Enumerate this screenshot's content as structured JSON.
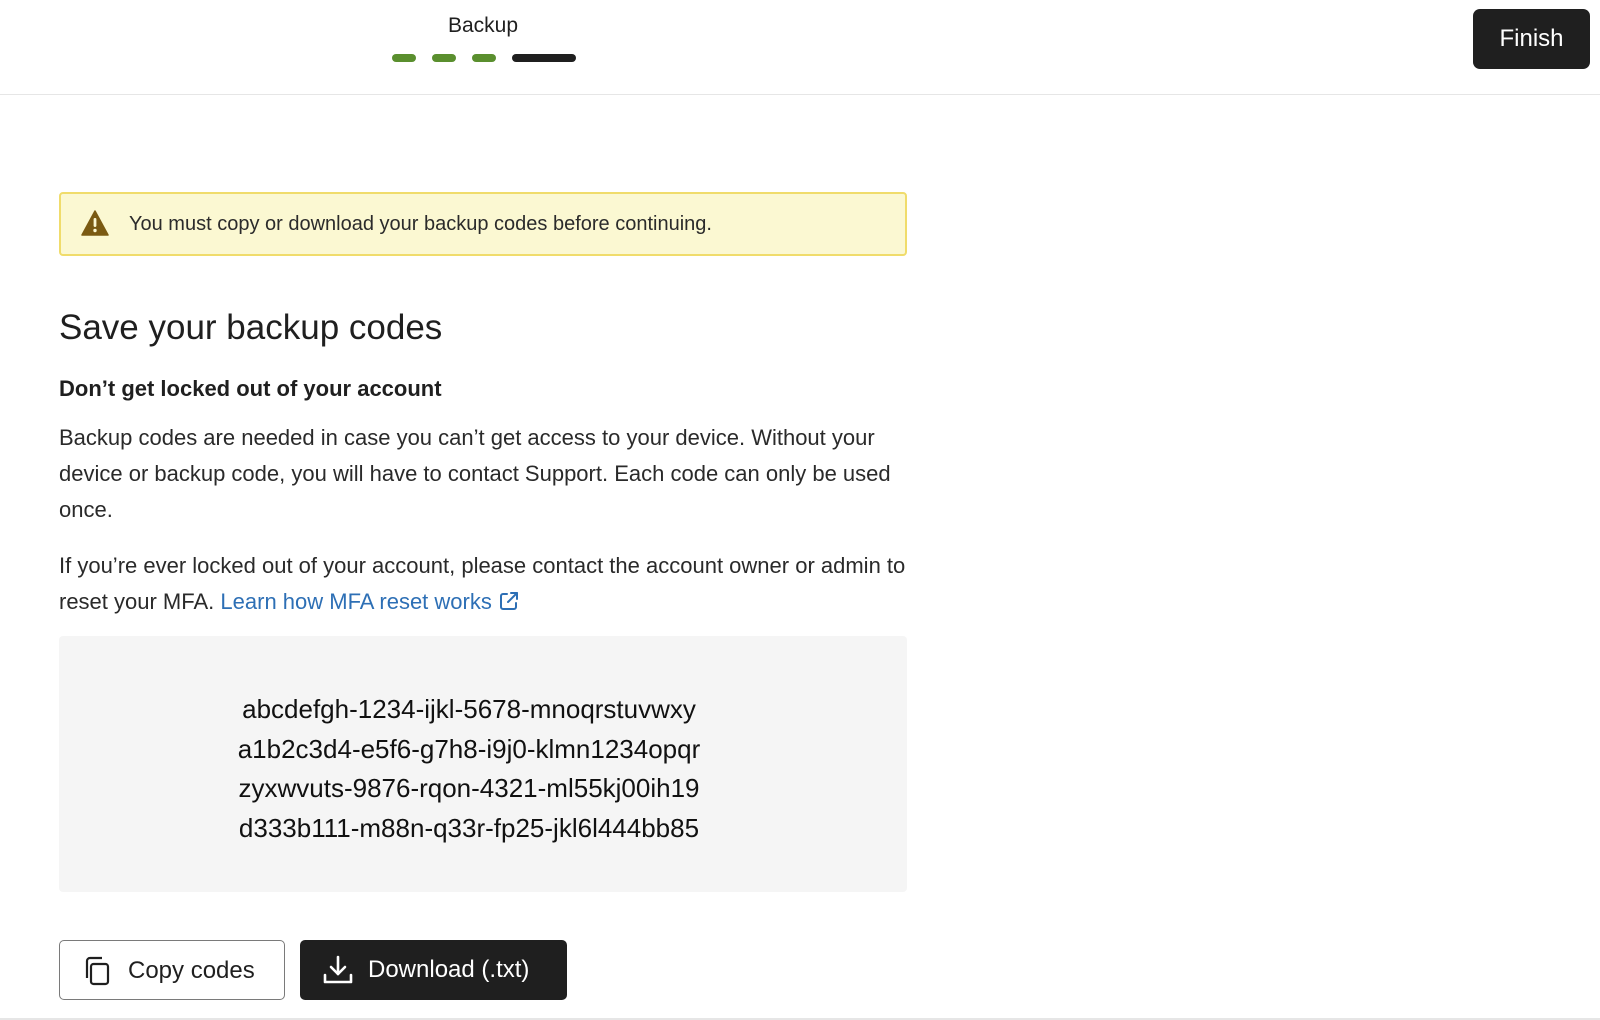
{
  "header": {
    "step_title": "Backup",
    "finish_label": "Finish",
    "steps": [
      {
        "state": "complete",
        "color": "#5a8f2e"
      },
      {
        "state": "complete",
        "color": "#5a8f2e"
      },
      {
        "state": "complete",
        "color": "#5a8f2e"
      },
      {
        "state": "current",
        "color": "#1f1f1f"
      }
    ]
  },
  "warning": {
    "icon": "warning-triangle-icon",
    "text": "You must copy or download your backup codes before continuing."
  },
  "main": {
    "heading": "Save your backup codes",
    "subheading": "Don’t get locked out of your account",
    "paragraph1": "Backup codes are needed in case you can’t get access to your device. Without your device or backup code, you will have to contact Support. Each code can only be used once.",
    "paragraph2": "If you’re ever locked out of your account, please contact the account owner or admin to reset your MFA.",
    "learn_link": "Learn how MFA reset works",
    "link_icon": "external-link-icon"
  },
  "codes": [
    "abcdefgh-1234-ijkl-5678-mnoqrstuvwxy",
    "a1b2c3d4-e5f6-g7h8-i9j0-klmn1234opqr",
    "zyxwvuts-9876-rqon-4321-ml55kj00ih19",
    "d333b111-m88n-q33r-fp25-jkl6l444bb85"
  ],
  "actions": {
    "copy_label": "Copy codes",
    "copy_icon": "copy-icon",
    "download_label": "Download (.txt)",
    "download_icon": "download-icon"
  },
  "colors": {
    "accent": "#1f1f1f",
    "link": "#2d6fb5",
    "warning_bg": "#fbf8d2",
    "warning_border": "#f0dc6b",
    "step_complete": "#5a8f2e"
  }
}
